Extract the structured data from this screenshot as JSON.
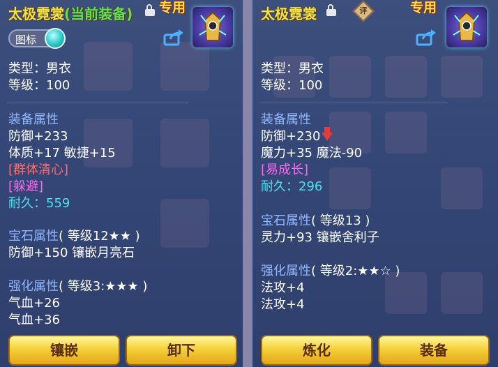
{
  "left": {
    "title_name": "太极霓裳",
    "title_tag": "(当前装备)",
    "exclusive": "专用",
    "icon_toggle_label": "图标",
    "type_label": "类型：男衣",
    "level_label": "等级：100",
    "equip_section": "装备属性",
    "stats": [
      "防御+233",
      "体质+17 敏捷+15"
    ],
    "special1": "[群体清心]",
    "special2": "[躲避]",
    "durability_label": "耐久：",
    "durability_value": "559",
    "gem_section": "宝石属性",
    "gem_level": "( 等级12★★ )",
    "gem_stat": "防御+150 镶嵌月亮石",
    "enhance_section": "强化属性",
    "enhance_level": "( 等级3:★★★ )",
    "enhance_stats": [
      "气血+26",
      "气血+36"
    ],
    "btn_inlay": "镶嵌",
    "btn_remove": "卸下"
  },
  "right": {
    "title_name": "太极霓裳",
    "rate_label": "评",
    "exclusive": "专用",
    "type_label": "类型：男衣",
    "level_label": "等级：100",
    "equip_section": "装备属性",
    "stat_defense": "防御+230",
    "stat_magic": "魔力+35 魔法-90",
    "special1": "[易成长]",
    "durability_label": "耐久：",
    "durability_value": "296",
    "gem_section": "宝石属性",
    "gem_level": "( 等级13 )",
    "gem_stat": "灵力+93 镶嵌舍利子",
    "enhance_section": "强化属性",
    "enhance_level": "( 等级2:★★☆ )",
    "enhance_stats": [
      "法攻+4",
      "法攻+4"
    ],
    "btn_refine": "炼化",
    "btn_equip": "装备"
  },
  "colors": {
    "title": "#f2e24a",
    "current_tag": "#5ee05a",
    "section": "#8fb8ff",
    "special_red": "#ff6a6a",
    "special_pink": "#ff66ee",
    "durability": "#4fe0f2",
    "button": "#f5d13a"
  },
  "icons": {
    "lock": "lock-icon",
    "share": "share-icon",
    "item": "robe-item-icon",
    "down_arrow": "down-arrow-icon",
    "rate": "rate-badge-icon"
  }
}
